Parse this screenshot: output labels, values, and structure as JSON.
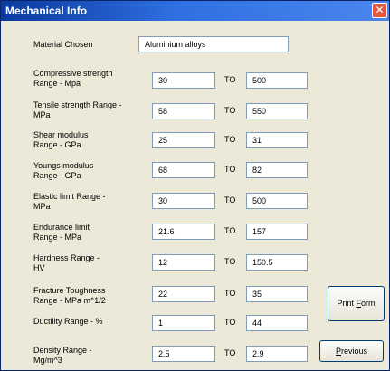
{
  "window": {
    "title": "Mechanical Info",
    "close_glyph": "✕"
  },
  "material": {
    "label": "Material Chosen",
    "value": "Aluminium alloys"
  },
  "range_separator": "TO",
  "ranges": [
    {
      "line1": "Compressive strength",
      "line2": "Range - Mpa",
      "min": "30",
      "max": "500"
    },
    {
      "line1": "Tensile strength Range -",
      "line2": "MPa",
      "min": "58",
      "max": "550"
    },
    {
      "line1": "Shear modulus",
      "line2": "Range - GPa",
      "min": "25",
      "max": "31"
    },
    {
      "line1": "Youngs modulus",
      "line2": "Range - GPa",
      "min": "68",
      "max": "82"
    },
    {
      "line1": "Elastic limit Range -",
      "line2": "MPa",
      "min": "30",
      "max": "500"
    },
    {
      "line1": "Endurance limit",
      "line2": "Range - MPa",
      "min": "21.6",
      "max": "157"
    },
    {
      "line1": "Hardness Range -",
      "line2": "HV",
      "min": "12",
      "max": "150.5"
    },
    {
      "line1": "Fracture Toughness",
      "line2": "Range - MPa m^1/2",
      "min": "22",
      "max": "35"
    },
    {
      "line1": "Ductility Range - %",
      "line2": "",
      "min": "1",
      "max": "44"
    },
    {
      "line1": "Density Range -",
      "line2": "Mg/m^3",
      "min": "2.5",
      "max": "2.9"
    }
  ],
  "buttons": {
    "print_form": {
      "before": "Print ",
      "accel": "F",
      "after": "orm"
    },
    "previous": {
      "before": "",
      "accel": "P",
      "after": "revious"
    }
  }
}
